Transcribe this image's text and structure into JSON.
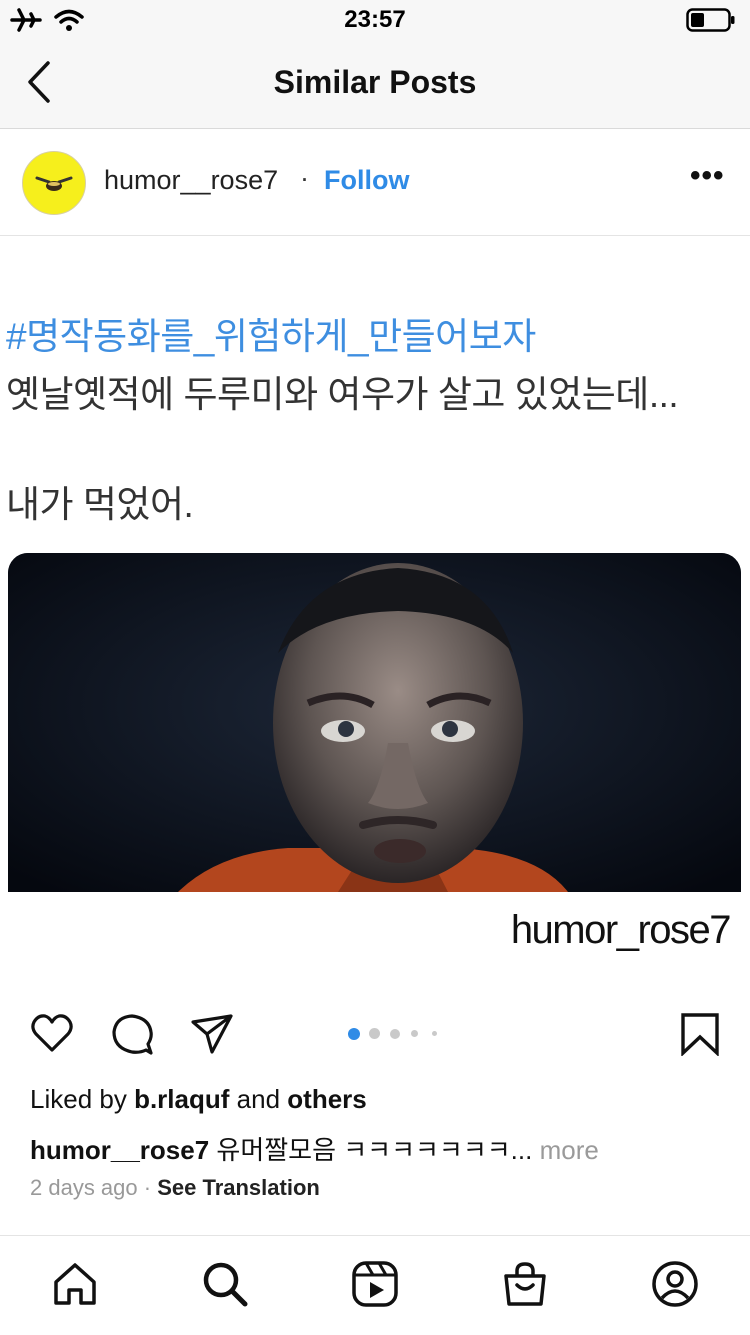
{
  "status_bar": {
    "time": "23:57",
    "icons": [
      "airplane-icon",
      "wifi-icon",
      "battery-icon"
    ]
  },
  "nav": {
    "title": "Similar Posts",
    "back_icon": "back-chevron-icon"
  },
  "post": {
    "username": "humor__rose7",
    "separator": "·",
    "follow_label": "Follow",
    "more_label": "•••",
    "content": {
      "hashtag": "#명작동화를_위험하게_만들어보자",
      "line1": "옛날옛적에 두루미와 여우가 살고 있었는데...",
      "line2": "내가 먹었어.",
      "watermark": "humor_rose7"
    },
    "carousel": {
      "count": 5,
      "active_index": 0
    },
    "likes": {
      "prefix": "Liked by",
      "user": "b.rlaquf",
      "and": "and",
      "others": "others"
    },
    "caption": {
      "username": "humor__rose7",
      "text": "유머짤모음 ㅋㅋㅋㅋㅋㅋㅋ...",
      "more": "more"
    },
    "meta": {
      "time": "2 days ago",
      "dot": "·",
      "translate": "See Translation"
    }
  },
  "colors": {
    "link": "#2f8be6",
    "hashtag": "#3e8ee0",
    "avatar": "#f6ef1c",
    "bar_bg": "#f7f7f7"
  },
  "tab_bar": {
    "icons": [
      "home-icon",
      "search-icon",
      "reels-icon",
      "shop-icon",
      "profile-icon"
    ]
  }
}
